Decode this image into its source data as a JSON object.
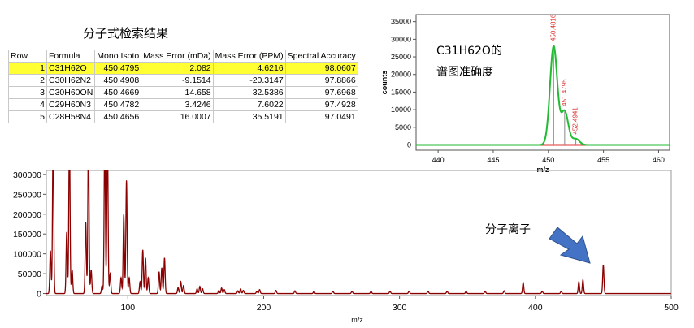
{
  "table": {
    "title": "分子式检索结果",
    "columns": [
      "Row",
      "Formula",
      "Mono Isoto",
      "Mass Error (mDa)",
      "Mass Error (PPM)",
      "Spectral Accuracy"
    ],
    "rows": [
      [
        "1",
        "C31H62O",
        "450.4795",
        "2.082",
        "4.6216",
        "98.0607"
      ],
      [
        "2",
        "C30H62N2",
        "450.4908",
        "-9.1514",
        "-20.3147",
        "97.8866"
      ],
      [
        "3",
        "C30H60ON",
        "450.4669",
        "14.658",
        "32.5386",
        "97.6968"
      ],
      [
        "4",
        "C29H60N3",
        "450.4782",
        "3.4246",
        "7.6022",
        "97.4928"
      ],
      [
        "5",
        "C28H58N4",
        "450.4656",
        "16.0007",
        "35.5191",
        "97.0491"
      ]
    ],
    "highlight_color": "#ffff33"
  },
  "inset": {
    "note_line1": "C31H62O的",
    "note_line2": "谱图准确度"
  },
  "main": {
    "annotation": "分子离子",
    "arrow_color": "#4472c4"
  },
  "chart_data": [
    {
      "type": "line",
      "title": "",
      "xlabel": "m/z",
      "ylabel": "counts",
      "xlim": [
        438,
        461
      ],
      "ylim": [
        -1500,
        37000
      ],
      "x_ticks": [
        440,
        445,
        450,
        455,
        460
      ],
      "y_ticks": [
        0,
        5000,
        10000,
        15000,
        20000,
        25000,
        30000,
        35000
      ],
      "series": [
        {
          "role": "measured",
          "color": "#22bb33",
          "peaks": [
            {
              "mz": 450.4816,
              "height": 28000,
              "width": 0.33
            },
            {
              "mz": 451.4795,
              "height": 9500,
              "width": 0.33
            },
            {
              "mz": 452.4941,
              "height": 1700,
              "width": 0.33
            }
          ]
        },
        {
          "role": "theoretical",
          "color": "#e03030",
          "baseline": 0
        }
      ],
      "stick_lines": [
        {
          "mz": 450.4816,
          "height": 28000
        },
        {
          "mz": 451.4795,
          "height": 9600
        },
        {
          "mz": 452.4941,
          "height": 1600
        }
      ],
      "peak_labels": [
        "450.4816",
        "451.4795",
        "452.4941"
      ]
    },
    {
      "type": "line",
      "title": "",
      "xlabel": "m/z",
      "xlim": [
        40,
        500
      ],
      "ylim": [
        -5000,
        310000
      ],
      "x_ticks": [
        100,
        200,
        300,
        400,
        500
      ],
      "y_ticks": [
        0,
        50000,
        100000,
        150000,
        200000,
        250000,
        300000
      ],
      "series": [
        {
          "color": "#8b0000",
          "peaks": [
            [
              43,
              108000
            ],
            [
              45,
              400000
            ],
            [
              55,
              155000
            ],
            [
              57,
              400000
            ],
            [
              59,
              60000
            ],
            [
              69,
              180000
            ],
            [
              71,
              400000
            ],
            [
              73,
              60000
            ],
            [
              81,
              20000
            ],
            [
              83,
              400000
            ],
            [
              85,
              400000
            ],
            [
              87,
              50000
            ],
            [
              95,
              40000
            ],
            [
              97,
              200000
            ],
            [
              99,
              285000
            ],
            [
              101,
              40000
            ],
            [
              109,
              30000
            ],
            [
              111,
              110000
            ],
            [
              113,
              90000
            ],
            [
              115,
              40000
            ],
            [
              123,
              55000
            ],
            [
              125,
              65000
            ],
            [
              127,
              90000
            ],
            [
              137,
              15000
            ],
            [
              139,
              30000
            ],
            [
              141,
              20000
            ],
            [
              151,
              12000
            ],
            [
              153,
              18000
            ],
            [
              155,
              12000
            ],
            [
              167,
              8000
            ],
            [
              169,
              14000
            ],
            [
              171,
              10000
            ],
            [
              181,
              7000
            ],
            [
              183,
              12000
            ],
            [
              185,
              8000
            ],
            [
              195,
              6000
            ],
            [
              197,
              10000
            ],
            [
              209,
              8000
            ],
            [
              223,
              7000
            ],
            [
              237,
              6000
            ],
            [
              251,
              6000
            ],
            [
              265,
              6000
            ],
            [
              279,
              6000
            ],
            [
              293,
              6000
            ],
            [
              307,
              6000
            ],
            [
              321,
              6000
            ],
            [
              335,
              6000
            ],
            [
              349,
              6000
            ],
            [
              363,
              6000
            ],
            [
              377,
              7000
            ],
            [
              391,
              28000
            ],
            [
              405,
              6000
            ],
            [
              419,
              6000
            ],
            [
              432,
              30000
            ],
            [
              435,
              35000
            ],
            [
              450,
              72000
            ]
          ]
        }
      ]
    }
  ]
}
